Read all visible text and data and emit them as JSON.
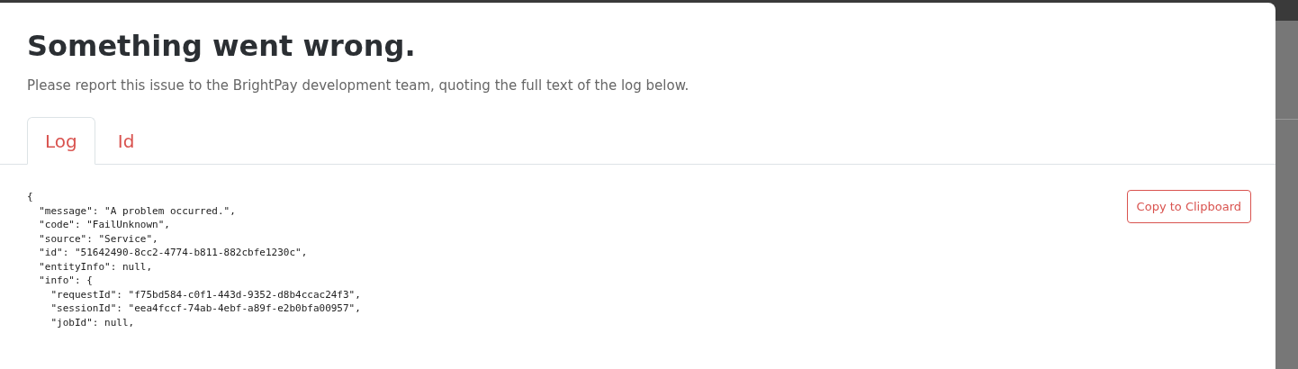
{
  "dialog": {
    "title": "Something went wrong.",
    "message": "Please report this issue to the BrightPay development team, quoting the full text of the log below."
  },
  "tabs": [
    {
      "label": "Log",
      "selected": true
    },
    {
      "label": "Id",
      "selected": false
    }
  ],
  "log_lines": [
    "{",
    "  \"message\": \"A problem occurred.\",",
    "  \"code\": \"FailUnknown\",",
    "  \"source\": \"Service\",",
    "  \"id\": \"51642490-8cc2-4774-b811-882cbfe1230c\",",
    "  \"entityInfo\": null,",
    "  \"info\": {",
    "    \"requestId\": \"f75bd584-c0f1-443d-9352-d8b4ccac24f3\",",
    "    \"sessionId\": \"eea4fccf-74ab-4ebf-a89f-e2b0bfa00957\",",
    "    \"jobId\": null,"
  ],
  "copy_button": "Copy to Clipboard"
}
